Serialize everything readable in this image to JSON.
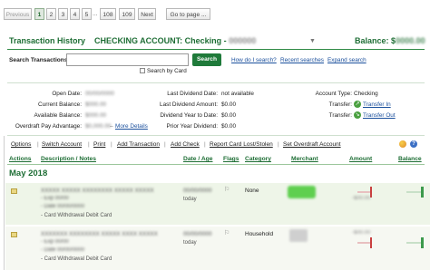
{
  "pagination": {
    "previous": "Previous",
    "pages": [
      "1",
      "2",
      "3",
      "4",
      "5"
    ],
    "ellipsis": "...",
    "later_pages": [
      "108",
      "109"
    ],
    "next": "Next",
    "goto": "Go to page ..."
  },
  "header": {
    "title": "Transaction History",
    "account_prefix": "CHECKING ACCOUNT: Checking -",
    "account_masked": "000000",
    "balance_label": "Balance:",
    "balance_value": "$",
    "balance_masked": "0000.00"
  },
  "search": {
    "label": "Search Transactions:",
    "placeholder": "",
    "button": "Search",
    "help_link": "How do I search?",
    "recent_link": "Recent searches",
    "expand_link": "Expand search",
    "by_card_label": "Search by Card"
  },
  "details": {
    "open_date_label": "Open Date:",
    "open_date_value": "00/00/0000",
    "current_balance_label": "Current Balance:",
    "current_balance_value": "$000.00",
    "available_balance_label": "Available Balance:",
    "available_balance_value": "$000.00",
    "overdraft_label": "Overdraft Pay Advantage:",
    "overdraft_value": "$0,000.00",
    "more_details": "More Details",
    "last_div_date_label": "Last Dividend Date:",
    "last_div_date_value": "not available",
    "last_div_amount_label": "Last Dividend Amount:",
    "last_div_amount_value": "$0.00",
    "div_ytd_label": "Dividend Year to Date:",
    "div_ytd_value": "$0.00",
    "prior_year_label": "Prior Year Dividend:",
    "prior_year_value": "$0.00",
    "account_type_label": "Account Type:",
    "account_type_value": "Checking",
    "transfer_label_1": "Transfer:",
    "transfer_in": "Transfer In",
    "transfer_label_2": "Transfer:",
    "transfer_out": "Transfer Out"
  },
  "options": {
    "items": [
      "Options",
      "Switch Account",
      "Print",
      "Add Transaction",
      "Add Check",
      "Report Card Lost/Stolen",
      "Set Overdraft Account"
    ]
  },
  "columns": {
    "actions": "Actions",
    "description": "Description / Notes",
    "date": "Date / Age",
    "flags": "Flags",
    "category": "Category",
    "merchant": "Merchant",
    "amount": "Amount",
    "balance": "Balance"
  },
  "month": "May 2018",
  "transactions": [
    {
      "description": "XXXXX XXXXX XXXXXXXX XXXXX XXXXX",
      "exp": "- Exp 00/00",
      "date_line": "- Date 00/00/0000",
      "card_line": "- Card Withdrawal Debit Card",
      "date": "00/00/0000",
      "age": "today",
      "category": "None",
      "merchant_color": "#5fcf4f"
    },
    {
      "description": "XXXXXXX XXXXXXXX XXXXX XXXX XXXXX",
      "exp": "- Exp 00/00",
      "date_line": "- Date 00/00/0000",
      "card_line": "- Card Withdrawal Debit Card",
      "date": "00/00/0000",
      "age": "today",
      "category": "Household",
      "merchant_color": "#d8d8d8"
    }
  ],
  "colors": {
    "accent": "#1e6e35",
    "search_button": "#1f7a3a",
    "row_highlight": "#eef5e8"
  }
}
